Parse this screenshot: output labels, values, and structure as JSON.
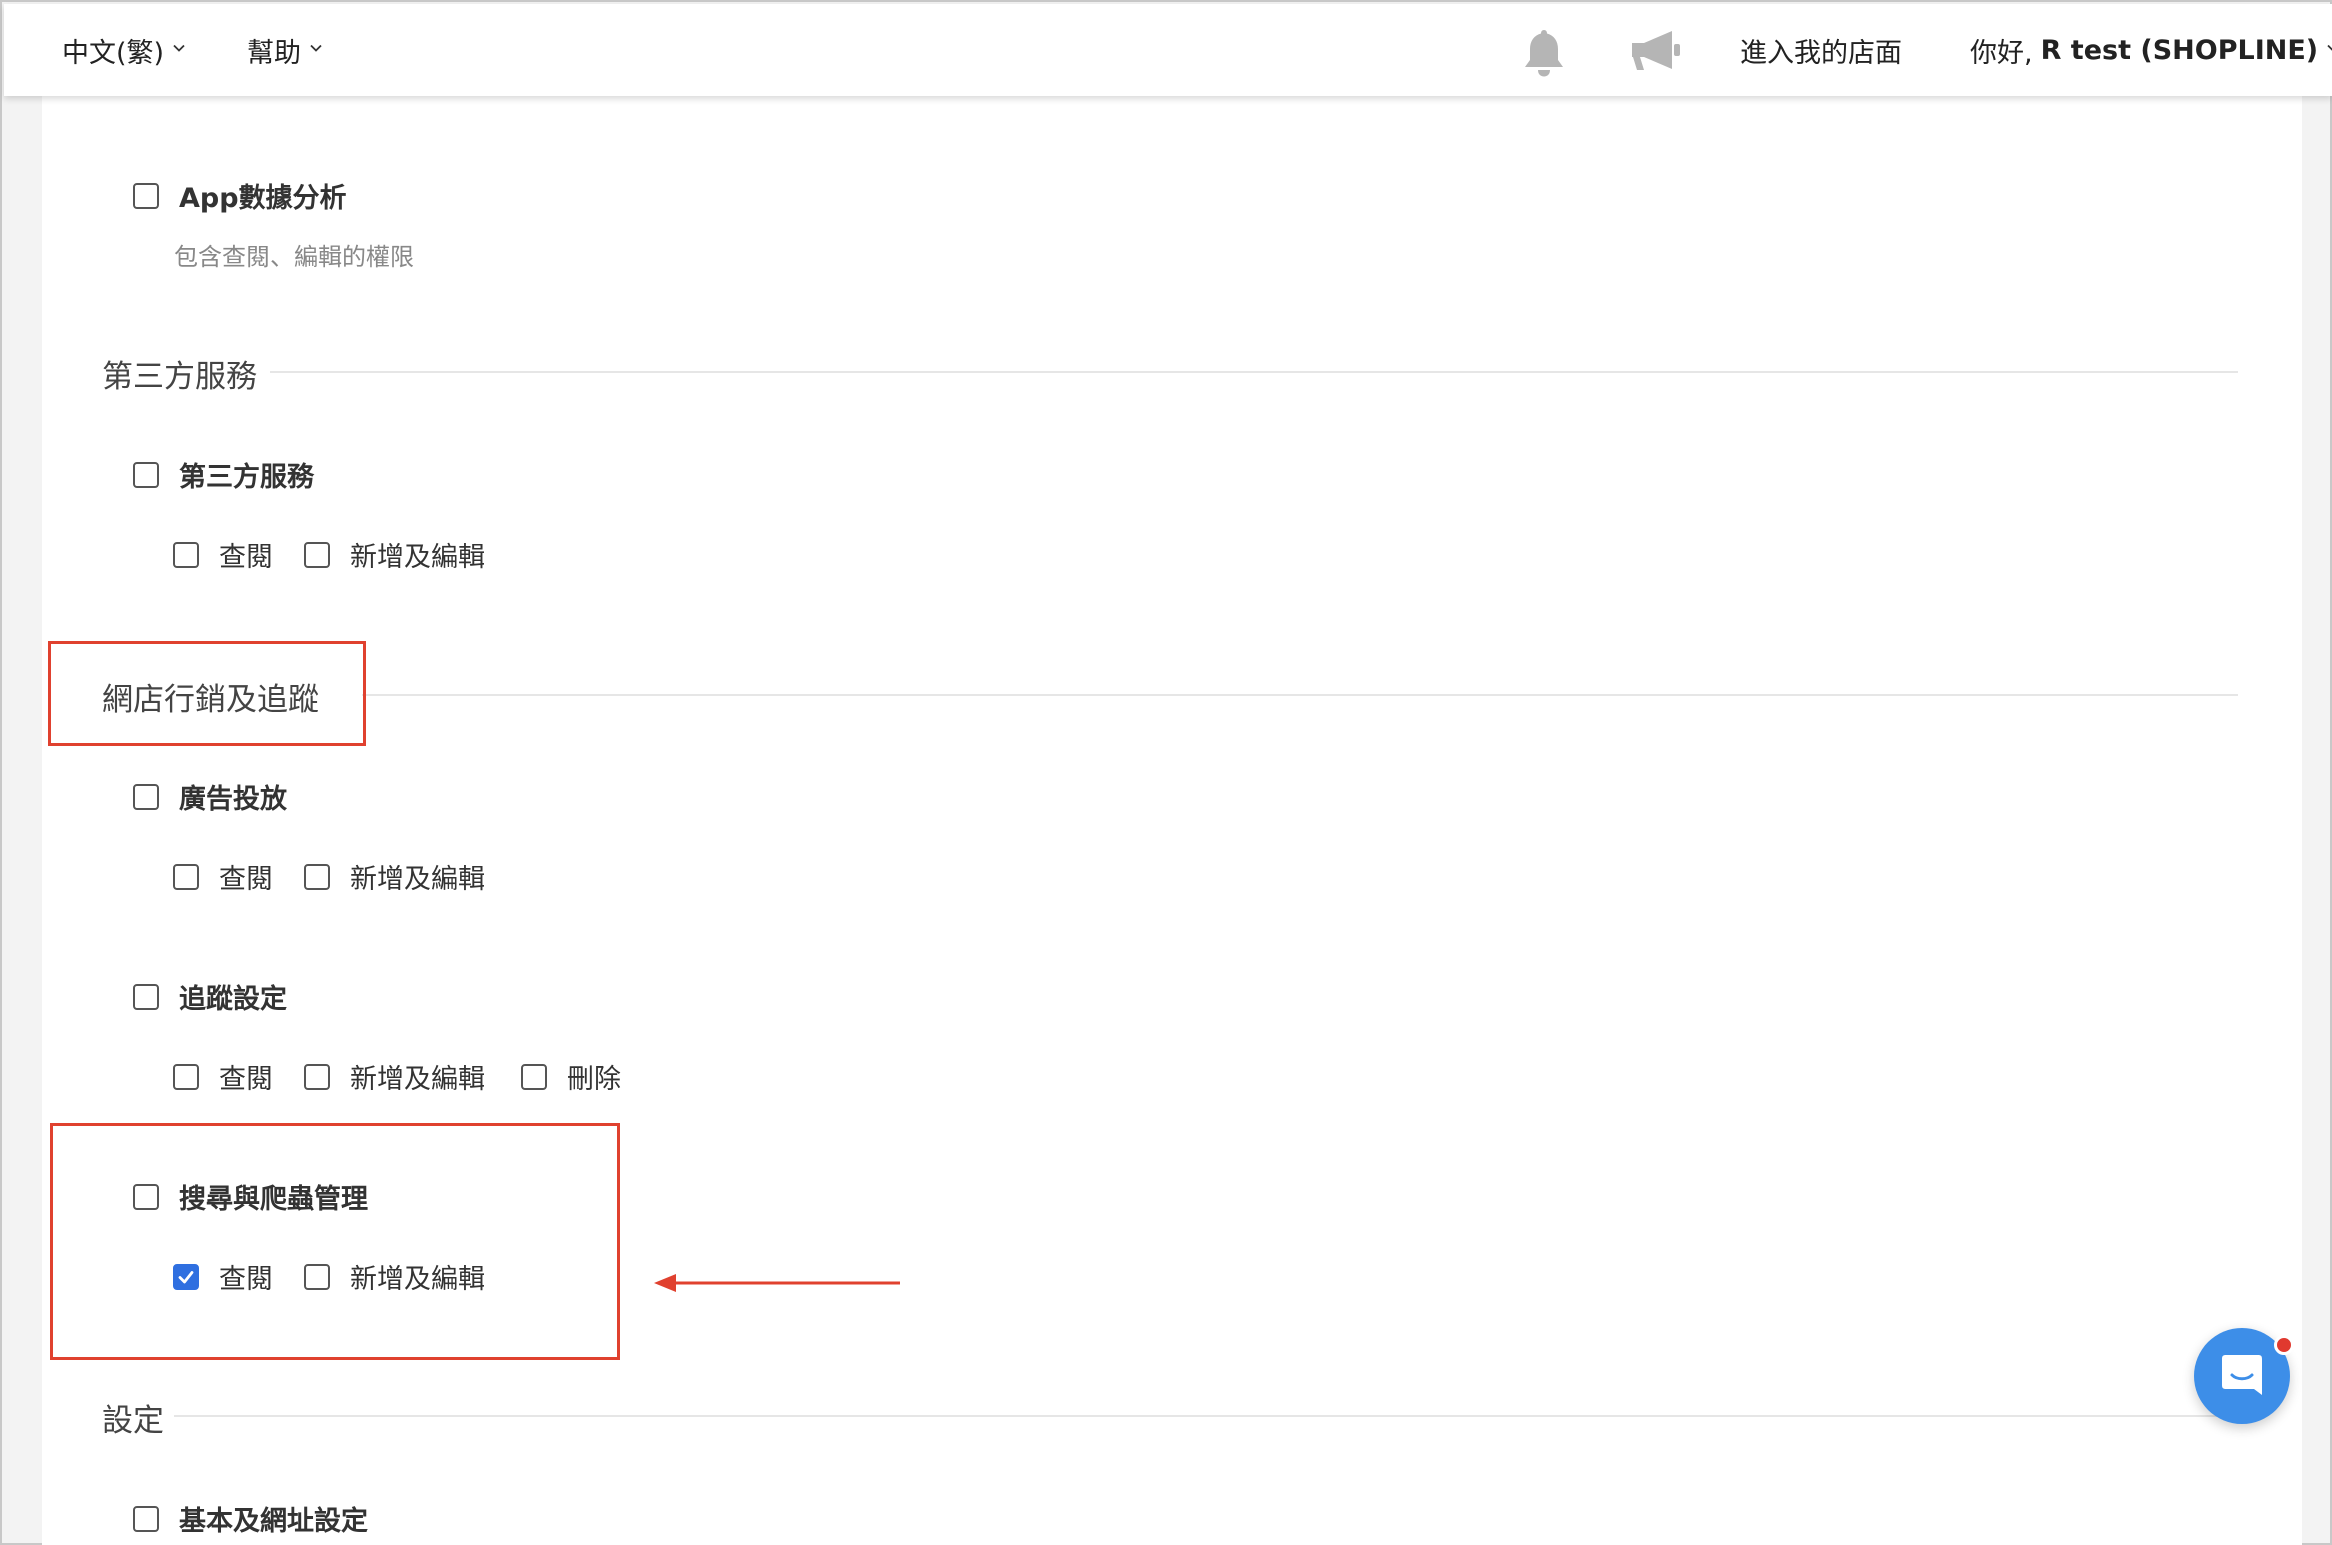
{
  "topbar": {
    "language": "中文(繁)",
    "help": "幫助",
    "storefront_link": "進入我的店面",
    "greeting_prefix": "你好,",
    "greeting_name": "R test (SHOPLINE)"
  },
  "permissions": {
    "app_analytics": {
      "title": "App數據分析",
      "description": "包含查閱、編輯的權限"
    },
    "sections": [
      {
        "title": "第三方服務",
        "groups": [
          {
            "title": "第三方服務",
            "options": [
              {
                "label": "查閱",
                "checked": false
              },
              {
                "label": "新增及編輯",
                "checked": false
              }
            ]
          }
        ]
      },
      {
        "title": "網店行銷及追蹤",
        "groups": [
          {
            "title": "廣告投放",
            "options": [
              {
                "label": "查閱",
                "checked": false
              },
              {
                "label": "新增及編輯",
                "checked": false
              }
            ]
          },
          {
            "title": "追蹤設定",
            "options": [
              {
                "label": "查閱",
                "checked": false
              },
              {
                "label": "新增及編輯",
                "checked": false
              },
              {
                "label": "刪除",
                "checked": false
              }
            ]
          },
          {
            "title": "搜尋與爬蟲管理",
            "options": [
              {
                "label": "查閱",
                "checked": true
              },
              {
                "label": "新增及編輯",
                "checked": false
              }
            ]
          }
        ]
      },
      {
        "title": "設定",
        "groups": [
          {
            "title": "基本及網址設定",
            "options": []
          }
        ]
      }
    ]
  },
  "colors": {
    "checkbox_checked": "#2f6fe0",
    "annotation": "#e0412f",
    "chat_button": "#3d8ee8"
  },
  "icons": {
    "notifications": "bell-icon",
    "announcements": "megaphone-icon",
    "chat": "chat-icon"
  }
}
